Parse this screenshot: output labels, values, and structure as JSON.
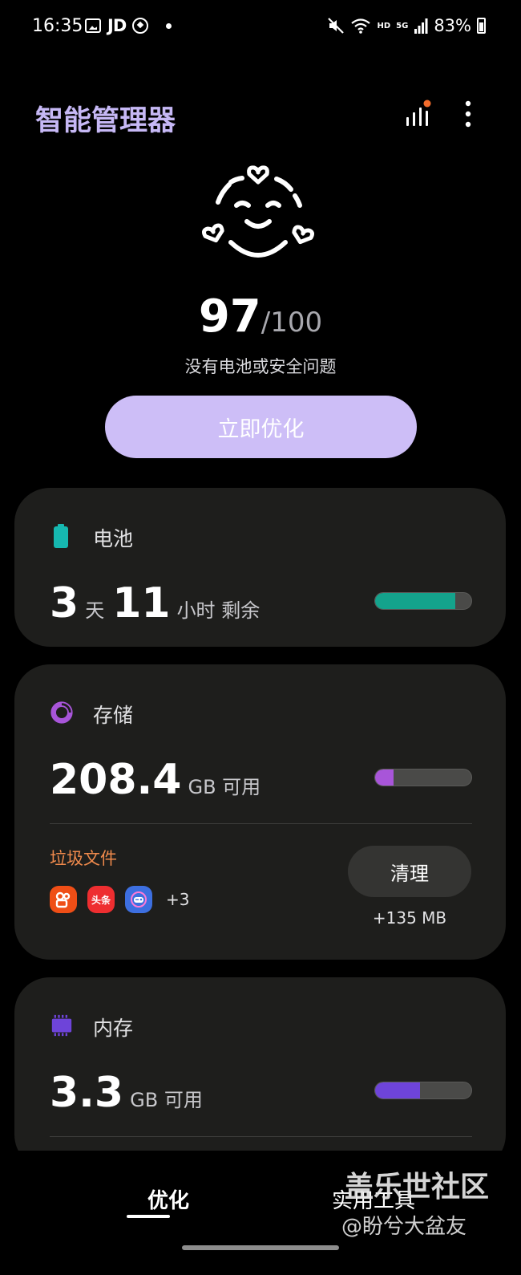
{
  "status_bar": {
    "time": "16:35",
    "jd": "JD",
    "hd": "HD",
    "net": "5G",
    "battery_pct": "83%",
    "icons": [
      "picture-icon",
      "jd-icon",
      "ring-icon",
      "notification-dot-icon",
      "mute-icon",
      "wifi-icon",
      "signal-icon",
      "battery-icon"
    ]
  },
  "header": {
    "title": "智能管理器",
    "icons": [
      "signal-bars-icon",
      "more-options-icon"
    ],
    "accent": "#c6b8f5",
    "notification_dot_color": "#f26c2c"
  },
  "status": {
    "score": "97",
    "max": "/100",
    "description": "没有电池或安全问题",
    "icon": "happy-face-icon"
  },
  "optimize_button": {
    "label": "立即优化",
    "color": "#cdbef7"
  },
  "battery": {
    "title": "电池",
    "icon": "battery-icon",
    "days": "3",
    "days_unit": "天",
    "hours": "11",
    "hours_unit": "小时 剩余",
    "level": 0.83,
    "color": "#14a38c"
  },
  "storage": {
    "title": "存储",
    "icon": "storage-pie-icon",
    "value": "208.4",
    "unit": "GB 可用",
    "used_fraction": 0.19,
    "color": "#a855d9",
    "junk": {
      "title": "垃圾文件",
      "apps": [
        {
          "name": "kuaishou-app-icon",
          "label": "",
          "color": "#ef4e16"
        },
        {
          "name": "toutiao-app-icon",
          "label": "头条",
          "color": "#ee2e30"
        },
        {
          "name": "game-app-icon",
          "label": "",
          "color": "#3d6fe0"
        }
      ],
      "more": "+3",
      "clean_label": "清理",
      "size": "+135 MB"
    }
  },
  "memory": {
    "title": "内存",
    "icon": "memory-chip-icon",
    "value": "3.3",
    "unit": "GB 可用",
    "used_fraction": 0.47,
    "color": "#6e44d9"
  },
  "bottom_nav": {
    "tabs": [
      {
        "label": "优化",
        "selected": true
      },
      {
        "label": "实用工具",
        "selected": false
      }
    ]
  },
  "watermark": {
    "title": "盖乐世社区",
    "user": "@盼兮大盆友"
  }
}
